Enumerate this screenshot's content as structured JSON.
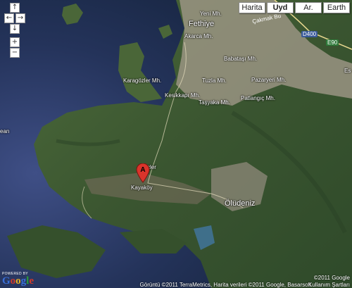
{
  "map_type_buttons": [
    "Harita",
    "Uyd",
    "Ar.",
    "Earth"
  ],
  "active_map_type": "Uyd",
  "pan_controls": {
    "up": "↑",
    "left": "←",
    "right": "→",
    "down": "↓"
  },
  "zoom_controls": {
    "in": "+",
    "out": "−"
  },
  "place_labels": {
    "yeni": "Yeni Mh.",
    "fethiye": "Fethiye",
    "akarca": "Akarca Mh.",
    "babatasi": "Babataşı Mh.",
    "karagozler": "Karagözler Mh.",
    "tuzla": "Tuzla Mh.",
    "pazaryeri": "Pazaryeri Mh.",
    "kesikkapi": "Kesikkapı Mh.",
    "patlangic": "Patlangıç Mh.",
    "tasyaka": "Taşyaka Mh.",
    "ean": "ean",
    "cler": "çler",
    "kayakoy": "Kayaköy",
    "oludeniz": "Ölüdeniz",
    "es": "Es"
  },
  "road_labels": {
    "cakmak": "Çakmak Bu",
    "d400": "D400",
    "e90": "E90"
  },
  "marker_label": "A",
  "powered_by": "POWERED BY",
  "logo_text": "Google",
  "attribution": "Görüntü ©2011 TerraMetrics, Harita verileri ©2011 Google, Basarsoft",
  "copyright": "©2011 Google",
  "terms": "Kullanım Şartları",
  "colors": {
    "sea": "#1b2c48",
    "land": "#3d5a2e",
    "urban": "#9a9482",
    "marker": "#d9342b"
  }
}
